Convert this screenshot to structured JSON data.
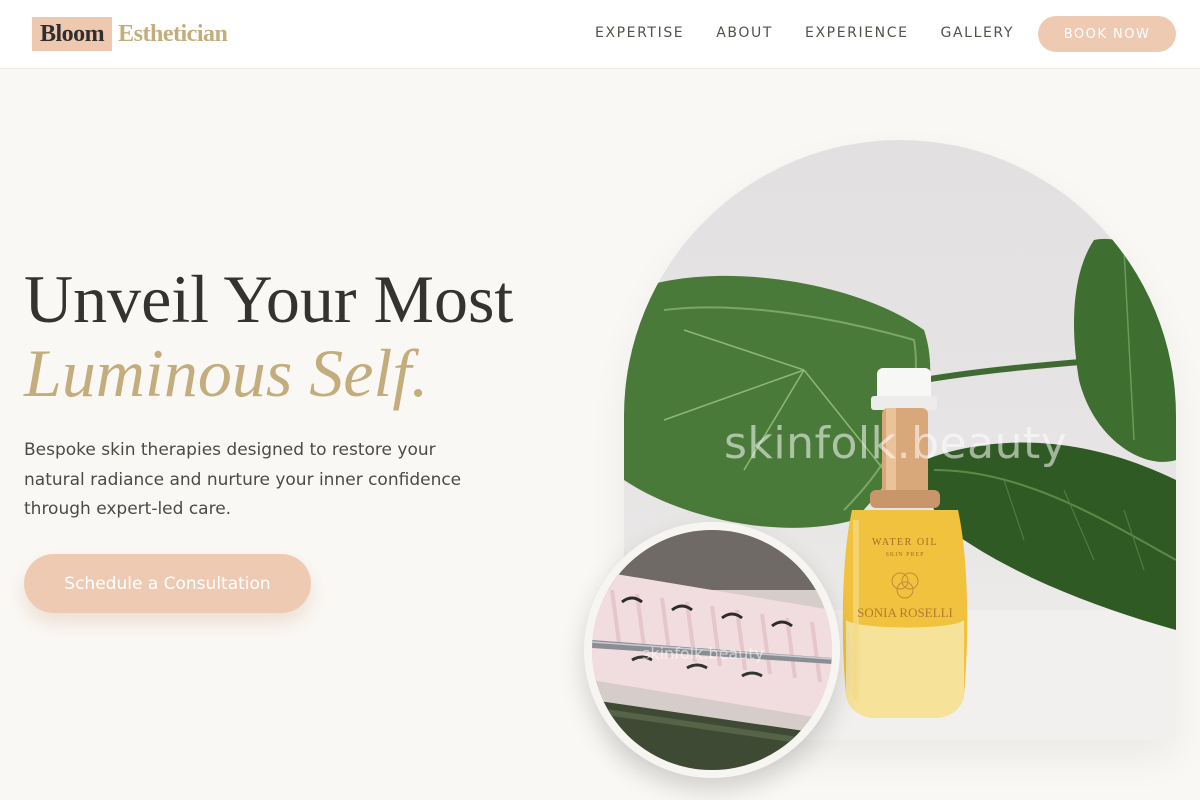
{
  "brand": {
    "name_part1": "Bloom",
    "name_part2": "Esthetician"
  },
  "nav": {
    "items": [
      "EXPERTISE",
      "ABOUT",
      "EXPERIENCE",
      "GALLERY"
    ],
    "book_label": "BOOK NOW"
  },
  "hero": {
    "headline_line1": "Unveil Your Most",
    "headline_line2": "Luminous Self.",
    "description": "Bespoke skin therapies designed to restore your natural radiance and nurture your inner confidence through expert-led care.",
    "cta_label": "Schedule a Consultation"
  },
  "images": {
    "main_watermark": "skinfolk.beauty",
    "bottle_label_line1": "WATER OIL",
    "bottle_label_line2": "SKIN PREP",
    "bottle_brand": "SONIA ROSELLI",
    "secondary_watermark": "skinfolk.beauty"
  },
  "colors": {
    "accent_peach": "#efcab2",
    "accent_gold": "#c4ad7c",
    "text_dark": "#333331",
    "background": "#faf8f5"
  }
}
